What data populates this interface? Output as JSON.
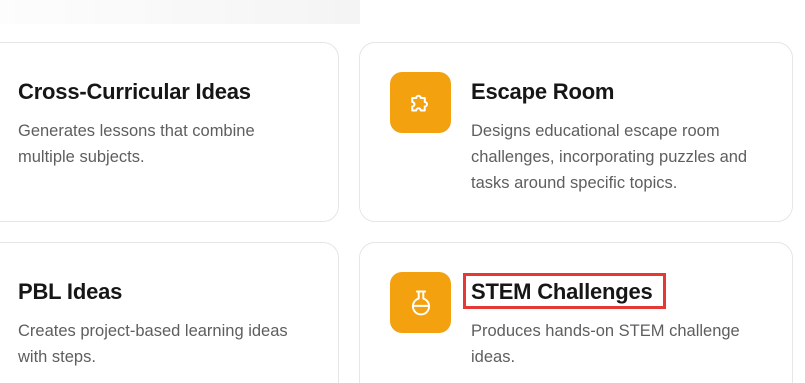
{
  "cards": [
    {
      "title": "Cross-Curricular Ideas",
      "description": "Generates lessons that combine multiple subjects."
    },
    {
      "title": "Escape Room",
      "description": "Designs educational escape room challenges, incorporating puzzles and tasks around specific topics.",
      "icon": "puzzle-icon"
    },
    {
      "title": "PBL Ideas",
      "description": "Creates project-based learning ideas with steps."
    },
    {
      "title": "STEM Challenges",
      "description": "Produces hands-on STEM challenge ideas.",
      "icon": "flask-icon"
    }
  ],
  "colors": {
    "icon_background": "#f4a10f",
    "highlight_border": "#e53935",
    "card_border": "#e6e6e6"
  }
}
